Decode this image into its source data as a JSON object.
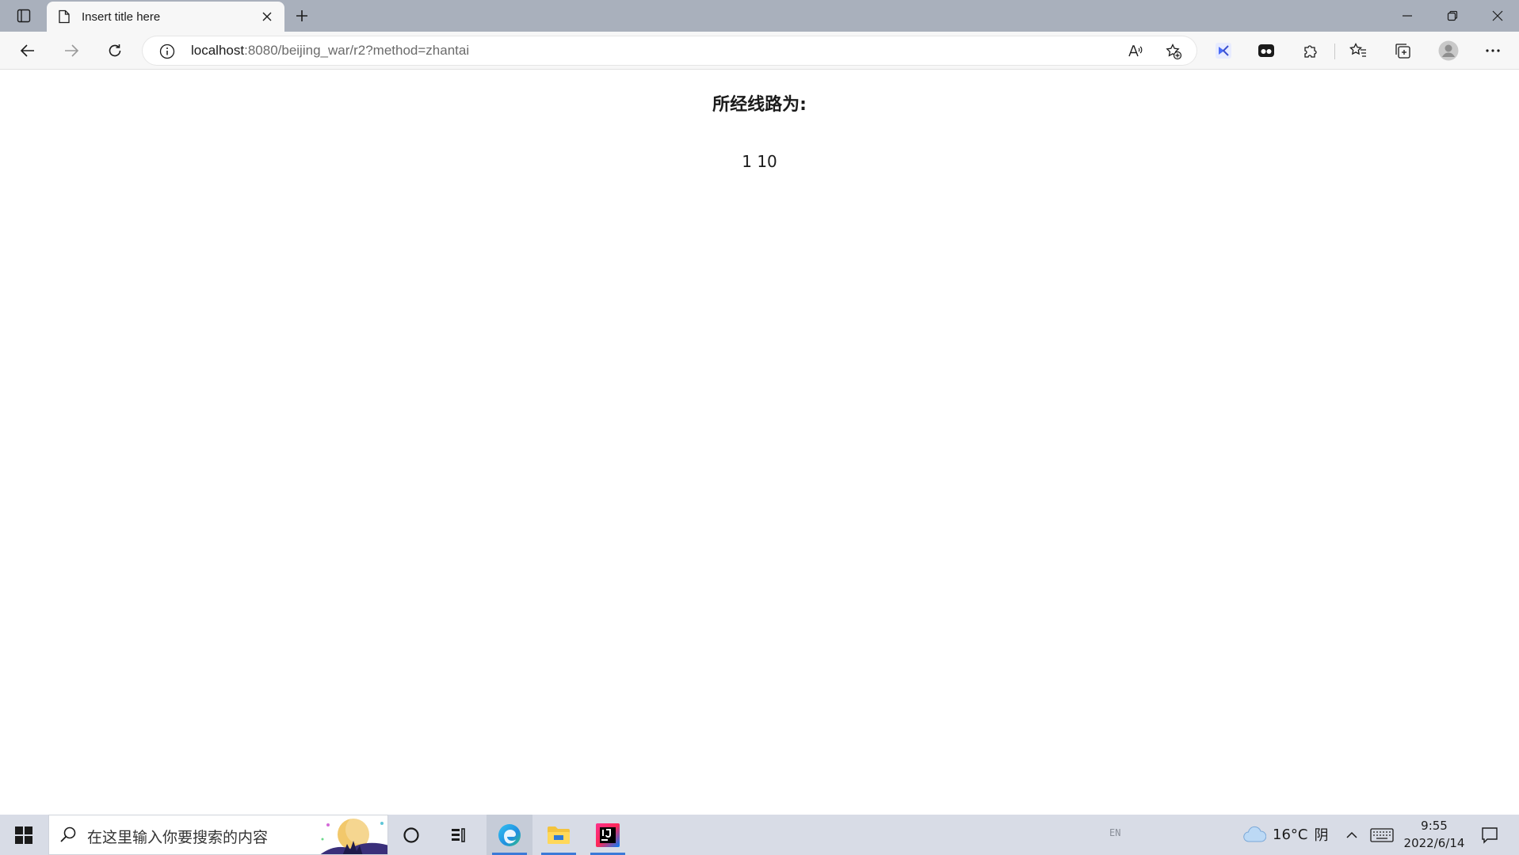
{
  "browser": {
    "tab_title": "Insert title here",
    "url_host": "localhost",
    "url_rest": ":8080/beijing_war/r2?method=zhantai"
  },
  "page": {
    "heading": "所经线路为:",
    "route": "1 10"
  },
  "taskbar": {
    "search_placeholder": "在这里输入你要搜索的内容",
    "ime_label": "EN",
    "weather_temp": "16°C",
    "weather_desc": "阴",
    "clock_time": "9:55",
    "clock_date": "2022/6/14"
  },
  "colors": {
    "tab_strip": "#a9b0bc",
    "toolbar": "#f7f7f7",
    "taskbar": "#d8dce6",
    "accent": "#3b7ad8"
  }
}
